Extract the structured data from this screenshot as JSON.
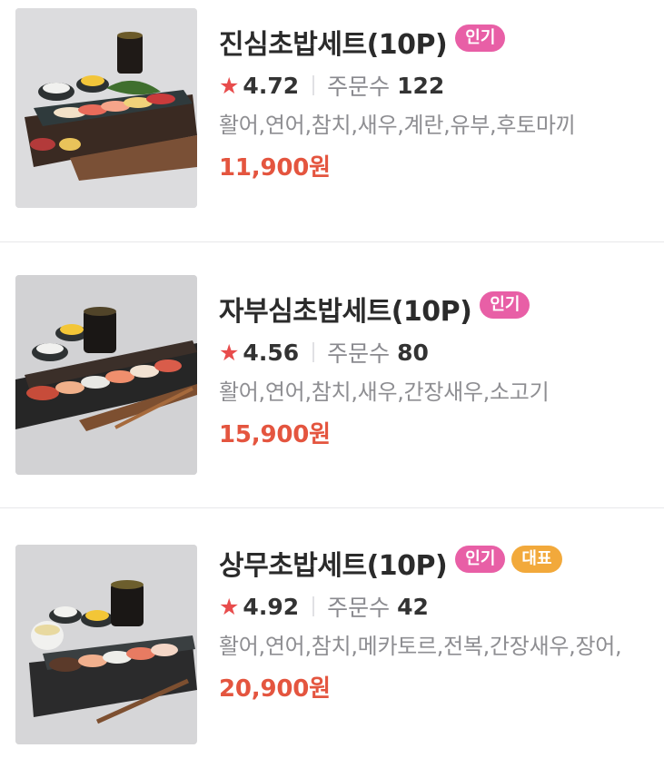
{
  "colors": {
    "price": "#e4553f",
    "star": "#e84c4c",
    "badge_popular": "#e85fa6",
    "badge_signature": "#f2a93b",
    "title": "#2b2b2b",
    "muted": "#8e8e92"
  },
  "icons": {
    "star": "★"
  },
  "menu_items": [
    {
      "name": "진심초밥세트(10P)",
      "badges": [
        "인기"
      ],
      "rating": "4.72",
      "orders_label": "주문수",
      "orders_count": "122",
      "description": "활어,연어,참치,새우,계란,유부,후토마끼",
      "price": "11,900원",
      "image": "sushi-set-photo"
    },
    {
      "name": "자부심초밥세트(10P)",
      "badges": [
        "인기"
      ],
      "rating": "4.56",
      "orders_label": "주문수",
      "orders_count": "80",
      "description": "활어,연어,참치,새우,간장새우,소고기",
      "price": "15,900원",
      "image": "sushi-set-photo"
    },
    {
      "name": "상무초밥세트(10P)",
      "badges": [
        "인기",
        "대표"
      ],
      "rating": "4.92",
      "orders_label": "주문수",
      "orders_count": "42",
      "description": "활어,연어,참치,메카토르,전복,간장새우,장어,",
      "price": "20,900원",
      "image": "sushi-set-photo"
    }
  ]
}
